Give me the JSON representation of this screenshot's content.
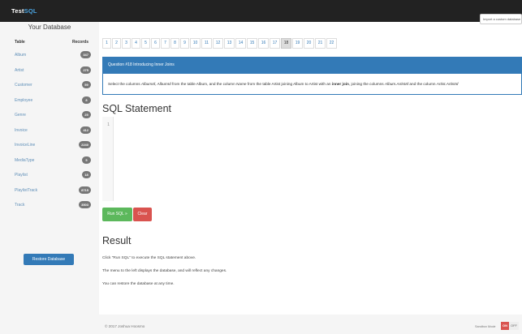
{
  "app": {
    "brand_prefix": "Test",
    "brand_suffix": "SQL",
    "import_label": "Import a custom database"
  },
  "sidebar": {
    "title": "Your Database",
    "col_table": "Table",
    "col_records": "Records",
    "tables": [
      {
        "name": "Album",
        "records": "347"
      },
      {
        "name": "Artist",
        "records": "275"
      },
      {
        "name": "Customer",
        "records": "59"
      },
      {
        "name": "Employee",
        "records": "8"
      },
      {
        "name": "Genre",
        "records": "25"
      },
      {
        "name": "Invoice",
        "records": "412"
      },
      {
        "name": "InvoiceLine",
        "records": "2240"
      },
      {
        "name": "MediaType",
        "records": "5"
      },
      {
        "name": "Playlist",
        "records": "18"
      },
      {
        "name": "PlaylistTrack",
        "records": "8715"
      },
      {
        "name": "Track",
        "records": "3503"
      }
    ],
    "restore_label": "Restore Database"
  },
  "pager": {
    "pages": [
      "1",
      "2",
      "3",
      "4",
      "5",
      "6",
      "7",
      "8",
      "9",
      "10",
      "11",
      "12",
      "13",
      "14",
      "15",
      "16",
      "17",
      "18",
      "19",
      "20",
      "21",
      "22"
    ],
    "active_page": "18"
  },
  "question": {
    "title": "Question #18 Introducing Inner Joins",
    "text_1": "Select the columns ",
    "em_1": "AlbumId, AlbumId",
    "text_2": " from the table Album, and the column ",
    "em_2": "Name",
    "text_3": " from the table Artist joining Album to Artist with an ",
    "strong_1": "inner join",
    "text_4": ", joining the columns ",
    "em_3": "Album.ArtistId",
    "text_5": " and the column ",
    "em_4": "Artist.ArtistId"
  },
  "editor": {
    "heading": "SQL Statement",
    "line_number": "1",
    "run_label": "Run SQL »",
    "clear_label": "Clear"
  },
  "result": {
    "heading": "Result",
    "lines": [
      "Click \"Run SQL\" to execute the SQL statement above.",
      "The menu to the left displays the database, and will reflect any changes.",
      "You can restore the database at any time."
    ]
  },
  "footer": {
    "copyright": "© 2017 Joshua Hoosmo",
    "sandbox_label": "Sandbox Mode",
    "on_label": "ON",
    "off_label": "OFF"
  }
}
